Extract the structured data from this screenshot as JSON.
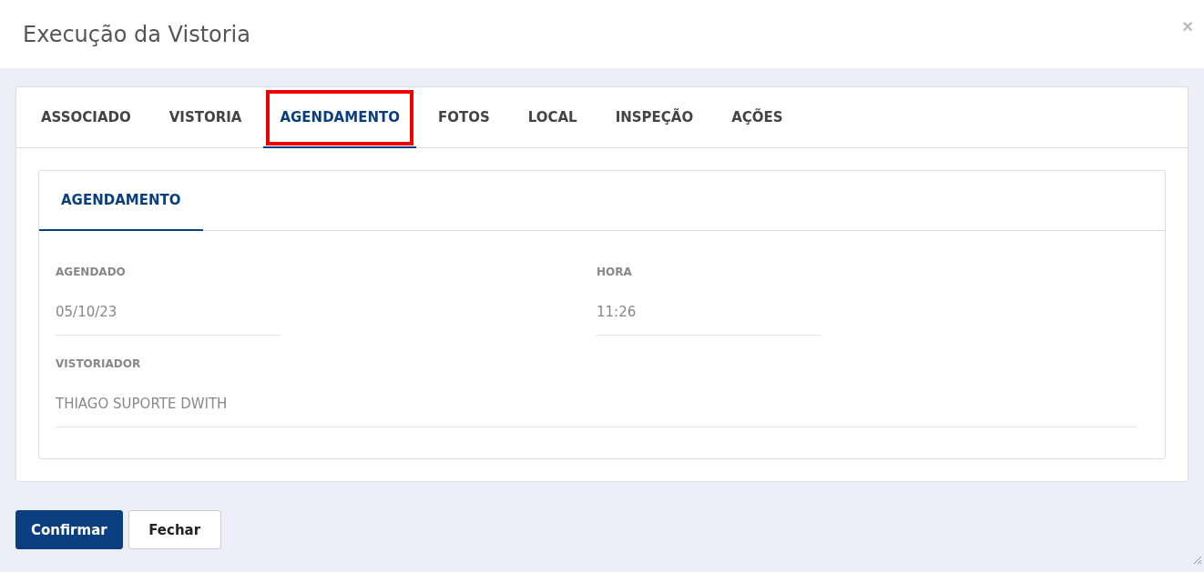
{
  "dialog": {
    "title": "Execução da Vistoria",
    "close": "×"
  },
  "tabs": [
    {
      "label": "ASSOCIADO",
      "selected": false,
      "highlighted": false
    },
    {
      "label": "VISTORIA",
      "selected": false,
      "highlighted": false
    },
    {
      "label": "AGENDAMENTO",
      "selected": true,
      "highlighted": true
    },
    {
      "label": "FOTOS",
      "selected": false,
      "highlighted": false
    },
    {
      "label": "LOCAL",
      "selected": false,
      "highlighted": false
    },
    {
      "label": "INSPEÇÃO",
      "selected": false,
      "highlighted": false
    },
    {
      "label": "AÇÕES",
      "selected": false,
      "highlighted": false
    }
  ],
  "section": {
    "tabs": [
      {
        "label": "AGENDAMENTO",
        "selected": true
      }
    ],
    "fields": [
      {
        "label": "AGENDADO",
        "value": "05/10/23",
        "wide": false
      },
      {
        "label": "HORA",
        "value": "11:26",
        "wide": false
      },
      {
        "label": "VISTORIADOR",
        "value": "THIAGO SUPORTE DWITH",
        "wide": true
      }
    ]
  },
  "buttons": [
    {
      "label": "Confirmar",
      "kind": "primary"
    },
    {
      "label": "Fechar",
      "kind": "secondary"
    }
  ]
}
